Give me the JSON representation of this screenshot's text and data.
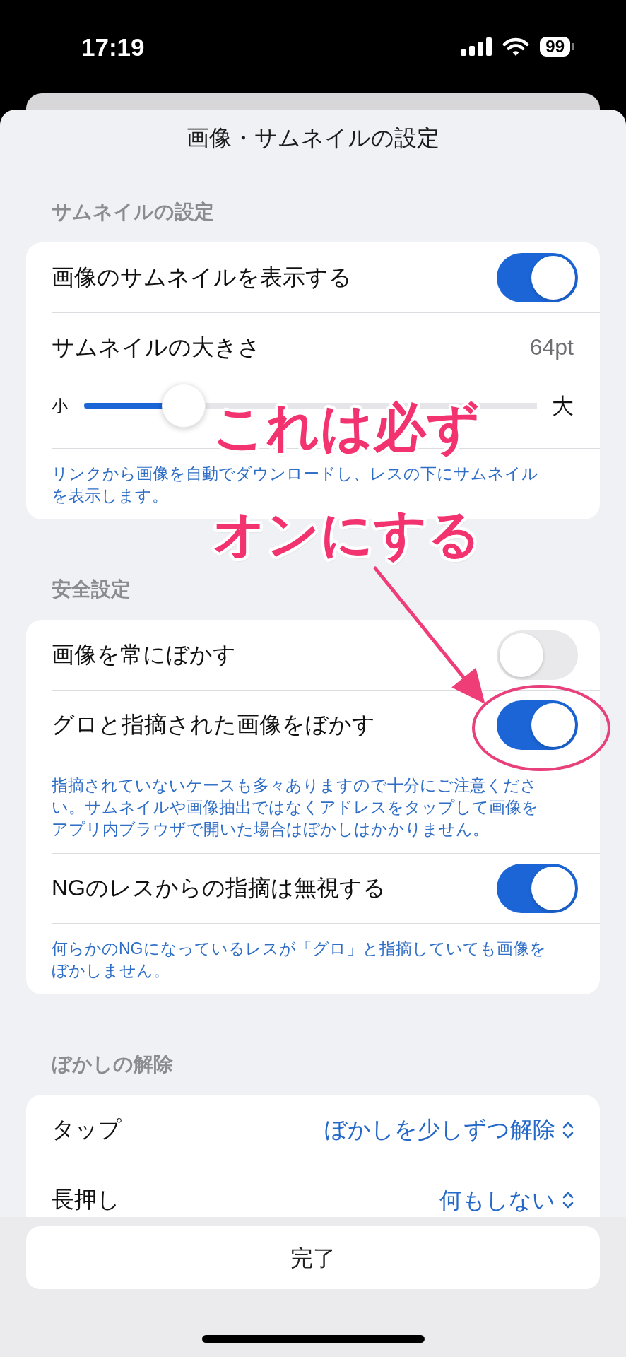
{
  "status_bar": {
    "time": "17:19",
    "battery": "99"
  },
  "sheet": {
    "title": "画像・サムネイルの設定"
  },
  "sections": [
    {
      "header": "サムネイルの設定",
      "items": [
        {
          "kind": "toggle",
          "label": "画像のサムネイルを表示する",
          "on": true
        },
        {
          "kind": "value",
          "label": "サムネイルの大きさ",
          "value": "64pt"
        },
        {
          "kind": "slider",
          "min_label": "小",
          "max_label": "大",
          "level": 0.22
        },
        {
          "kind": "note",
          "text": "リンクから画像を自動でダウンロードし、レスの下にサムネイルを表示します。"
        }
      ]
    },
    {
      "header": "安全設定",
      "items": [
        {
          "kind": "toggle",
          "label": "画像を常にぼかす",
          "on": false
        },
        {
          "kind": "toggle",
          "label": "グロと指摘された画像をぼかす",
          "on": true,
          "highlighted": true
        },
        {
          "kind": "note",
          "text": "指摘されていないケースも多々ありますので十分にご注意ください。サムネイルや画像抽出ではなくアドレスをタップして画像をアプリ内ブラウザで開いた場合はぼかしはかかりません。"
        },
        {
          "kind": "toggle",
          "label": "NGのレスからの指摘は無視する",
          "on": true
        },
        {
          "kind": "note",
          "text": "何らかのNGになっているレスが「グロ」と指摘していても画像をぼかしません。"
        }
      ]
    },
    {
      "header": "ぼかしの解除",
      "items": [
        {
          "kind": "picker",
          "label": "タップ",
          "value": "ぼかしを少しずつ解除"
        },
        {
          "kind": "picker",
          "label": "長押し",
          "value": "何もしない"
        }
      ]
    }
  ],
  "done_button": "完了",
  "annotation": {
    "lines": [
      "これは必ず",
      "オンにする"
    ]
  }
}
